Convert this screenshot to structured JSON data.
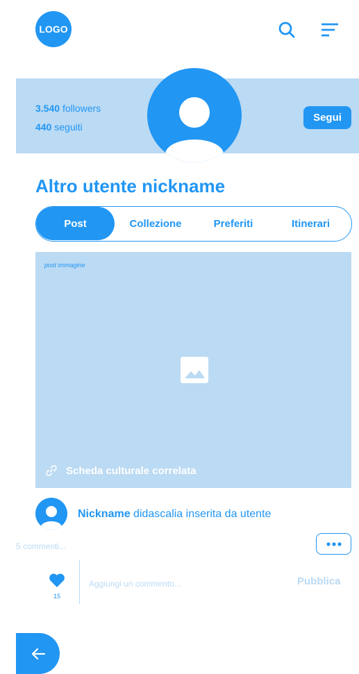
{
  "header": {
    "logo_text": "LOGO",
    "search_icon": "search-icon",
    "menu_icon": "menu-icon"
  },
  "profile": {
    "followers_count": "3.540",
    "followers_label": "followers",
    "following_count": "440",
    "following_label": "seguiti",
    "follow_button": "Segui",
    "nickname": "Altro utente nickname"
  },
  "tabs": [
    {
      "label": "Post",
      "active": true
    },
    {
      "label": "Collezione",
      "active": false
    },
    {
      "label": "Preferiti",
      "active": false
    },
    {
      "label": "Itinerari",
      "active": false
    }
  ],
  "post": {
    "image_label": "post immagine",
    "cultural_link": "Scheda culturale correlata",
    "author": "Nickname",
    "caption": "didascalia inserita da utente",
    "comments_count": "5 commenti...",
    "likes": "15",
    "comment_placeholder": "Aggiungi un commento...",
    "publish_label": "Pubblica"
  },
  "colors": {
    "primary": "#2196F3",
    "light": "#BBDAF3",
    "background": "#FFFFFF"
  }
}
